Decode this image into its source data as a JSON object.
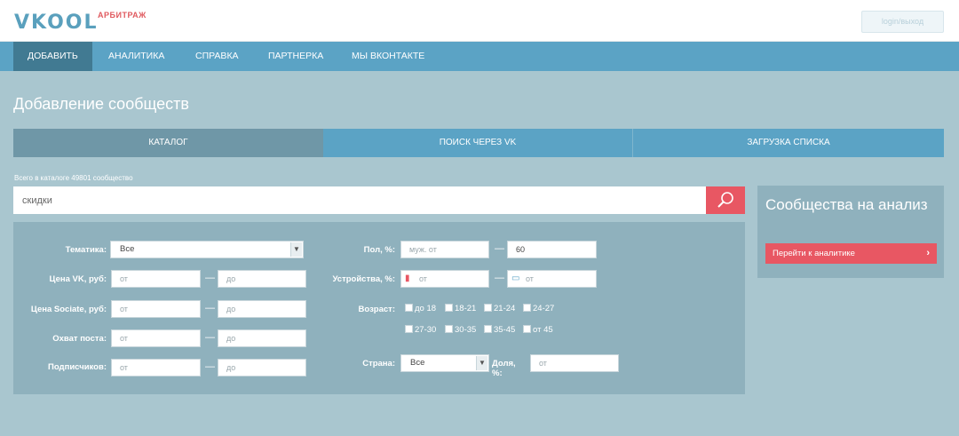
{
  "header": {
    "logo": "VKOOL",
    "logo_sub": "АРБИТРАЖ",
    "login_placeholder": "login/выход"
  },
  "nav": {
    "items": [
      {
        "label": "ДОБАВИТЬ",
        "active": true
      },
      {
        "label": "АНАЛИТИКА"
      },
      {
        "label": "СПРАВКА"
      },
      {
        "label": "ПАРТНЕРКА"
      },
      {
        "label": "МЫ ВКОНТАКТЕ"
      }
    ]
  },
  "page_title": "Добавление сообществ",
  "tabs": [
    {
      "label": "КАТАЛОГ",
      "active": true
    },
    {
      "label": "ПОИСК ЧЕРЕЗ VK"
    },
    {
      "label": "ЗАГРУЗКА СПИСКА"
    }
  ],
  "catalog_count": "Всего в каталоге 49801 сообщество",
  "search": {
    "value": "скидки"
  },
  "filters": {
    "topic": {
      "label": "Тематика:",
      "value": "Все"
    },
    "price_vk": {
      "label": "Цена VK, руб:",
      "from": "от",
      "to": "до"
    },
    "price_sociate": {
      "label": "Цена Sociate, руб:",
      "from": "от",
      "to": "до"
    },
    "post_reach": {
      "label": "Охват поста:",
      "from": "от",
      "to": "до"
    },
    "subscribers": {
      "label": "Подписчиков:",
      "from": "от",
      "to": "до"
    },
    "gender": {
      "label": "Пол, %:",
      "from": "муж. от",
      "to_value": "60"
    },
    "devices": {
      "label": "Устройства, %:",
      "mobile": "от",
      "desktop": "от"
    },
    "age": {
      "label": "Возраст:",
      "options": [
        "до 18",
        "18-21",
        "21-24",
        "24-27",
        "27-30",
        "30-35",
        "35-45",
        "от 45"
      ]
    },
    "country": {
      "label": "Страна:",
      "value": "Все"
    },
    "share": {
      "label": "Доля, %:",
      "placeholder": "от"
    }
  },
  "side": {
    "title": "Сообщества на анализ",
    "button": "Перейти к аналитике"
  },
  "colors": {
    "nav": "#5ba3c5",
    "nav_active": "#417a92",
    "accent_red": "#e85763",
    "page_bg": "#a9c6cf",
    "panel": "#8fb1bd"
  }
}
